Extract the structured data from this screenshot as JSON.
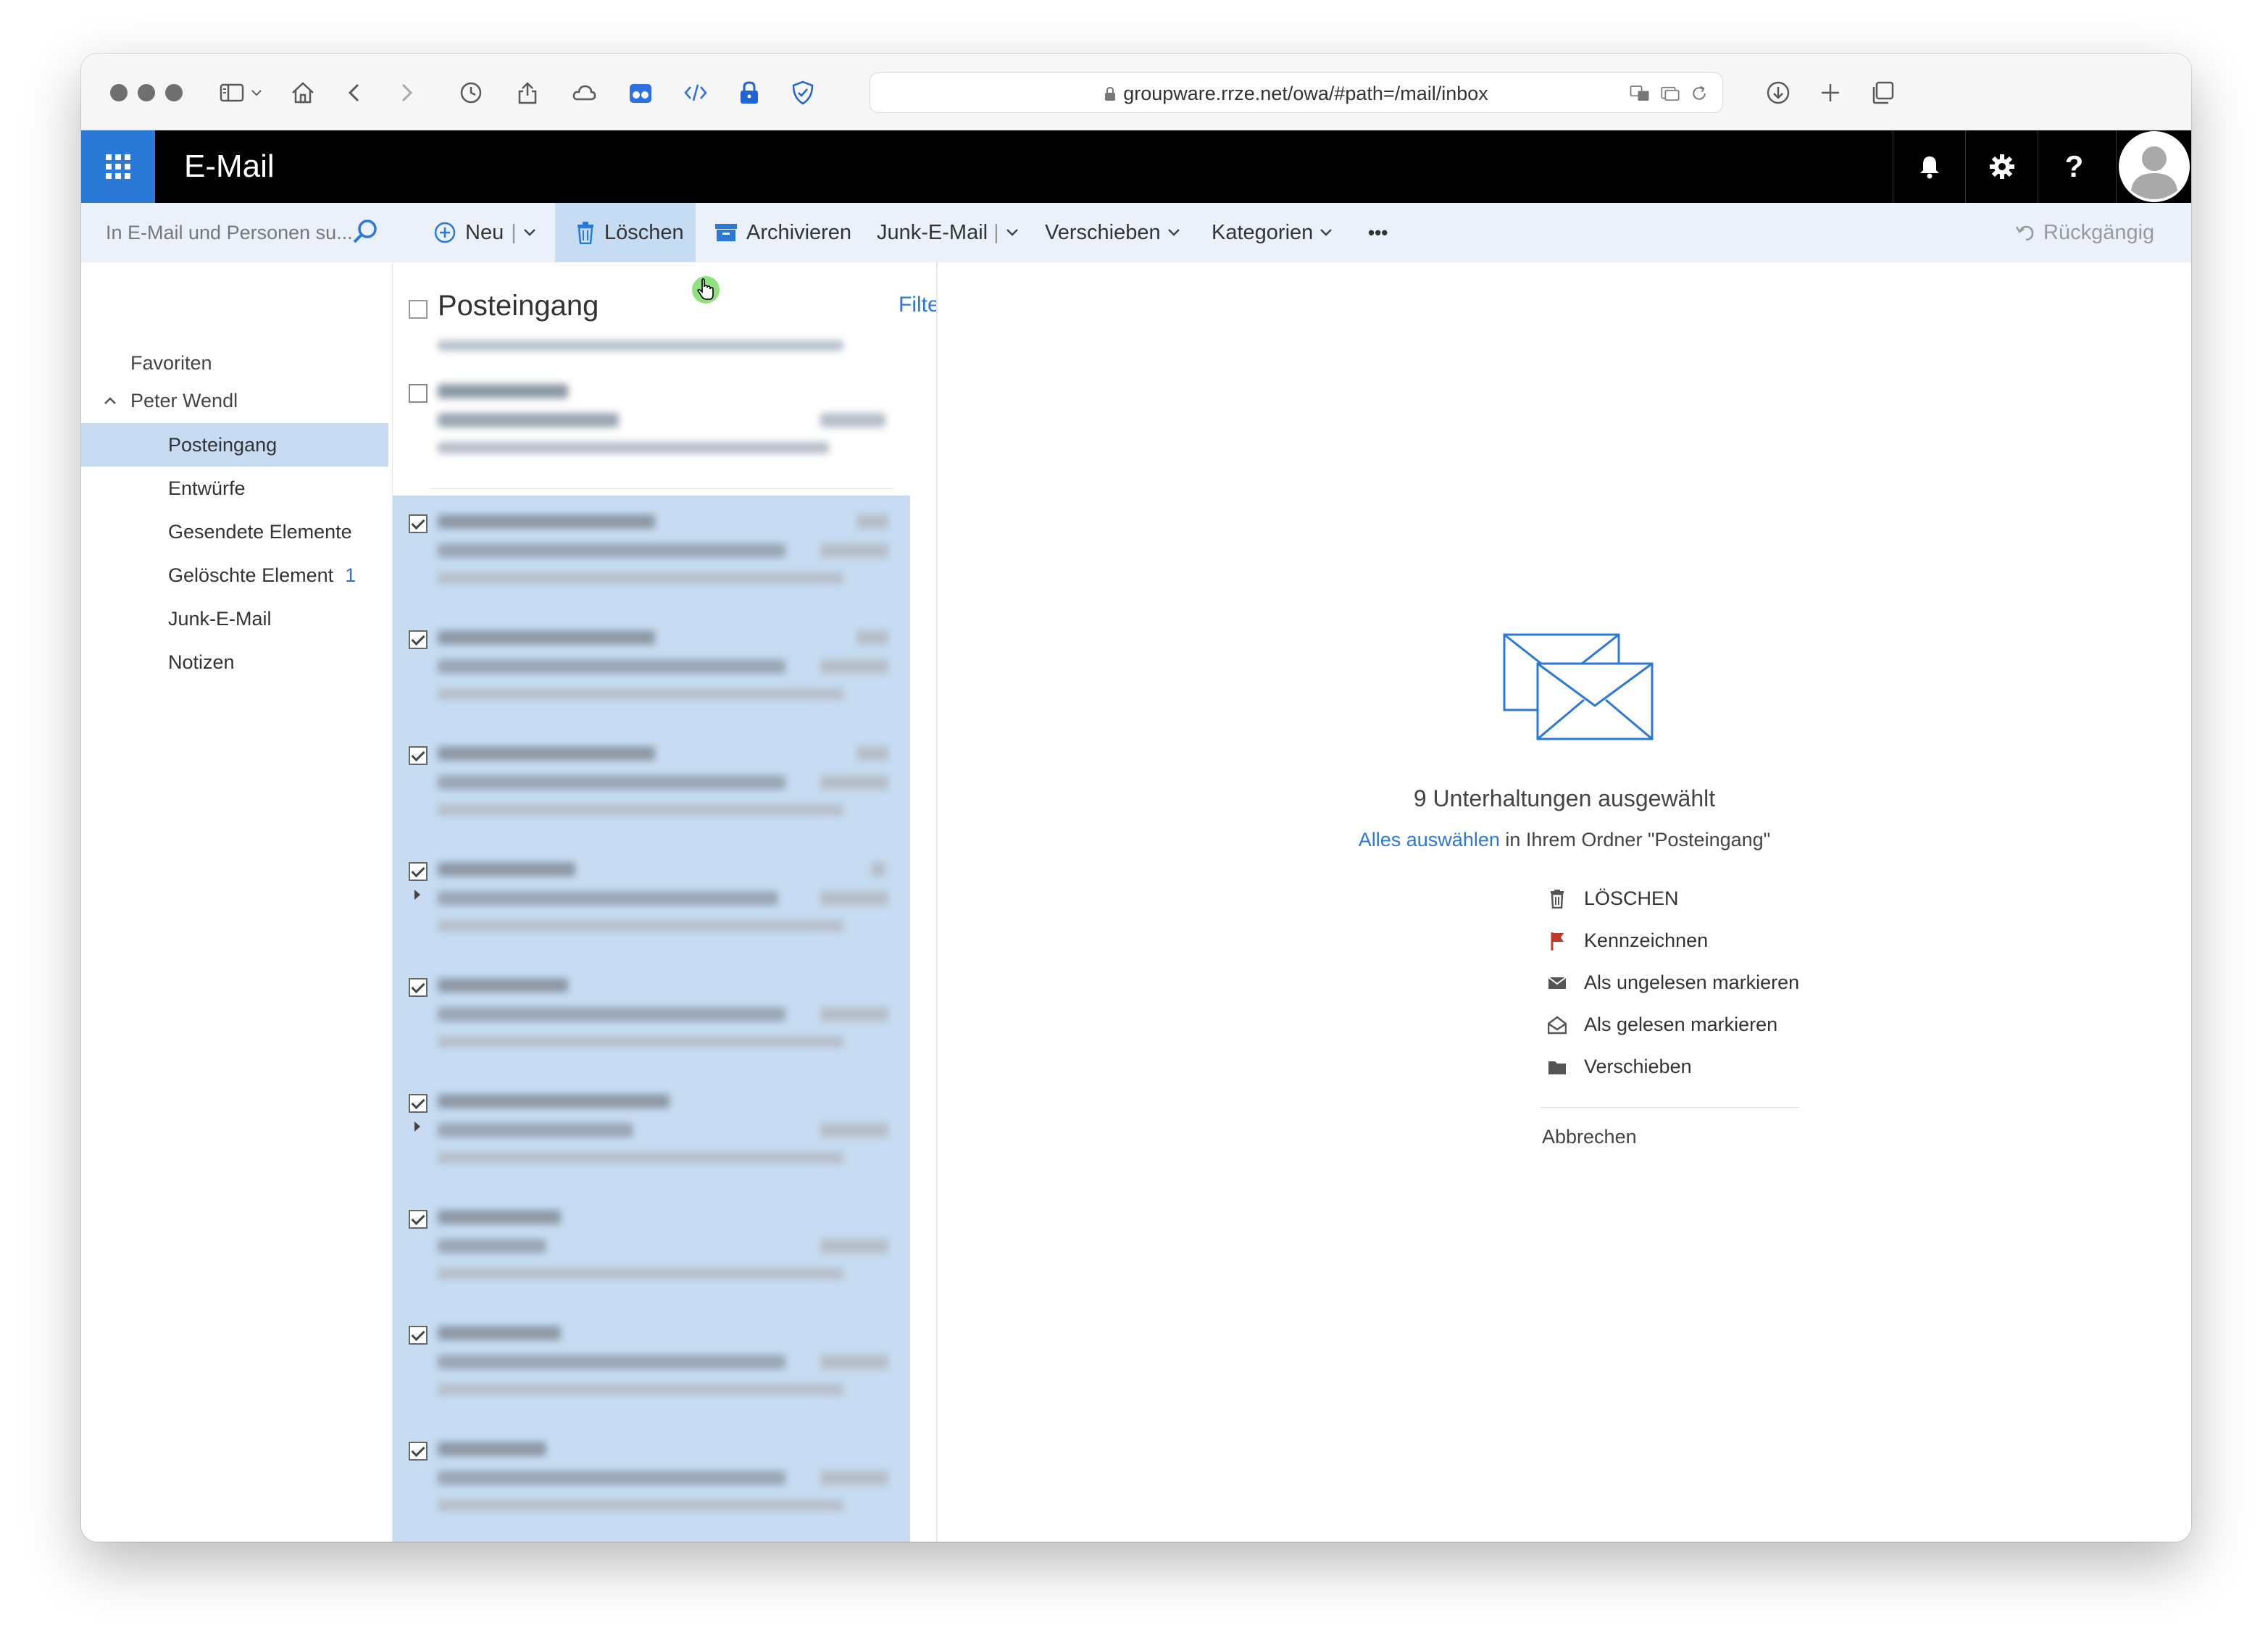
{
  "browser": {
    "url": "groupware.rrze.net/owa/#path=/mail/inbox",
    "icons": [
      "sidebar-icon",
      "chevron-down-icon",
      "home-icon",
      "back-icon",
      "forward-icon",
      "history-icon",
      "share-icon",
      "cloud-icon",
      "extension-icon",
      "code-icon",
      "lock-icon",
      "shield-icon",
      "translate-icon",
      "reader-icon",
      "reload-icon",
      "download-icon",
      "new-tab-icon",
      "tabs-overview-icon"
    ]
  },
  "header": {
    "app_title": "E-Mail",
    "accent": "#2b79d6"
  },
  "search": {
    "placeholder": "In E-Mail und Personen su..."
  },
  "commands": {
    "new_label": "Neu",
    "delete_label": "Löschen",
    "archive_label": "Archivieren",
    "junk_label": "Junk-E-Mail",
    "move_label": "Verschieben",
    "categories_label": "Kategorien",
    "more_label": "•••",
    "undo_label": "Rückgängig"
  },
  "folders": {
    "favorites_label": "Favoriten",
    "account_label": "Peter Wendl",
    "items": [
      {
        "label": "Posteingang",
        "count": ""
      },
      {
        "label": "Entwürfe",
        "count": ""
      },
      {
        "label": "Gesendete Elemente",
        "count": ""
      },
      {
        "label": "Gelöschte Element",
        "count": "1"
      },
      {
        "label": "Junk-E-Mail",
        "count": ""
      },
      {
        "label": "Notizen",
        "count": ""
      }
    ],
    "selected": "Posteingang"
  },
  "message_list": {
    "title": "Posteingang",
    "filter_label": "Filter",
    "selected_count": 9
  },
  "reading_pane": {
    "selection_text": "9 Unterhaltungen ausgewählt",
    "select_all_link": "Alles auswählen",
    "select_all_suffix": " in Ihrem Ordner \"Posteingang\"",
    "actions": [
      {
        "label": "LÖSCHEN",
        "icon": "trash-icon"
      },
      {
        "label": "Kennzeichnen",
        "icon": "flag-icon"
      },
      {
        "label": "Als ungelesen markieren",
        "icon": "envelope-closed-icon"
      },
      {
        "label": "Als gelesen markieren",
        "icon": "envelope-open-icon"
      },
      {
        "label": "Verschieben",
        "icon": "folder-icon"
      }
    ],
    "cancel_label": "Abbrechen"
  }
}
